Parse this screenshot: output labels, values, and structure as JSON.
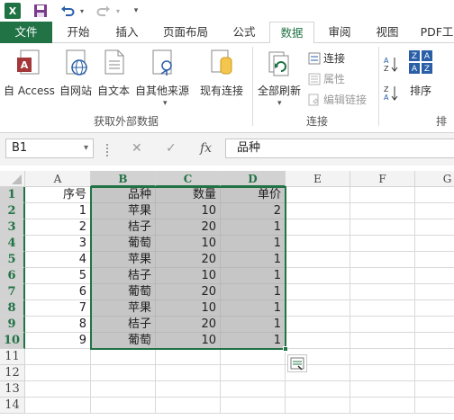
{
  "tabs": [
    {
      "label": "文件"
    },
    {
      "label": "开始"
    },
    {
      "label": "插入"
    },
    {
      "label": "页面布局"
    },
    {
      "label": "公式"
    },
    {
      "label": "数据"
    },
    {
      "label": "审阅"
    },
    {
      "label": "视图"
    },
    {
      "label": "PDF工"
    }
  ],
  "ribbon": {
    "get_external": {
      "access": "自 Access",
      "web": "自网站",
      "text": "自文本",
      "other": "自其他来源",
      "existing": "现有连接",
      "group_label": "获取外部数据"
    },
    "connections": {
      "refresh_all": "全部刷新",
      "connections": "连接",
      "properties": "属性",
      "edit_links": "编辑链接",
      "group_label": "连接"
    },
    "sort": {
      "sort": "排序",
      "group_label": "排"
    }
  },
  "formula_bar": {
    "name_box": "B1",
    "content": "品种",
    "cancel_symbol": "✕",
    "enter_symbol": "✓",
    "fx_symbol": "fx"
  },
  "columns": [
    "A",
    "B",
    "C",
    "D",
    "E",
    "F",
    "G"
  ],
  "rows": [
    "1",
    "2",
    "3",
    "4",
    "5",
    "6",
    "7",
    "8",
    "9",
    "10",
    "11",
    "12",
    "13",
    "14"
  ],
  "sheet": [
    [
      "序号",
      "品种",
      "数量",
      "单价"
    ],
    [
      "1",
      "苹果",
      "10",
      "2"
    ],
    [
      "2",
      "桔子",
      "20",
      "1"
    ],
    [
      "3",
      "葡萄",
      "10",
      "1"
    ],
    [
      "4",
      "苹果",
      "20",
      "1"
    ],
    [
      "5",
      "桔子",
      "10",
      "1"
    ],
    [
      "6",
      "葡萄",
      "20",
      "1"
    ],
    [
      "7",
      "苹果",
      "10",
      "1"
    ],
    [
      "8",
      "桔子",
      "20",
      "1"
    ],
    [
      "9",
      "葡萄",
      "10",
      "1"
    ]
  ],
  "colors": {
    "accent": "#217346",
    "selection_fill": "#c6c6c6"
  }
}
